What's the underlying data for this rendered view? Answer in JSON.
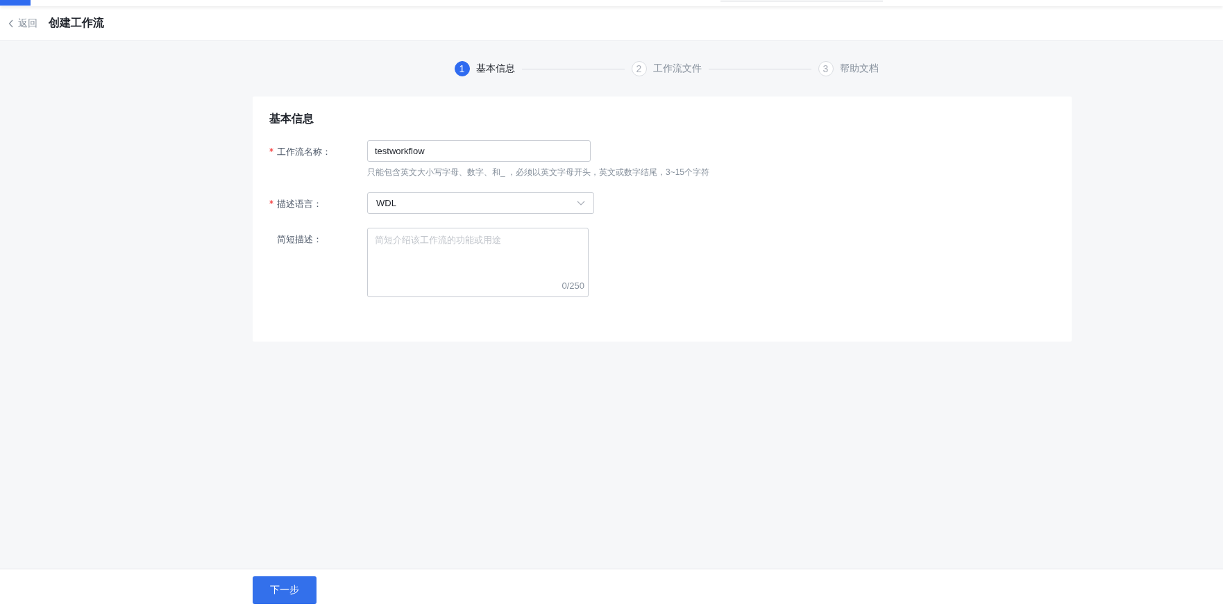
{
  "header": {
    "back_label": "返回",
    "title": "创建工作流"
  },
  "steps": [
    {
      "number": "1",
      "label": "基本信息",
      "selected": true
    },
    {
      "number": "2",
      "label": "工作流文件",
      "selected": false
    },
    {
      "number": "3",
      "label": "帮助文档",
      "selected": false
    }
  ],
  "form": {
    "title": "基本信息",
    "fields": [
      {
        "kind": "input",
        "label": "工作流名称：",
        "required": true,
        "value": "testworkflow",
        "hint": "只能包含英文大小写字母、数字、和_ ，必须以英文字母开头，英文或数字结尾，3~15个字符"
      },
      {
        "kind": "select",
        "label": "描述语言：",
        "required": true,
        "value": "WDL"
      },
      {
        "kind": "textarea",
        "label": "简短描述：",
        "required": false,
        "placeholder": "简短介绍该工作流的功能或用途",
        "counter": "0/250"
      }
    ]
  },
  "footer": {
    "next_button": "下一步"
  }
}
